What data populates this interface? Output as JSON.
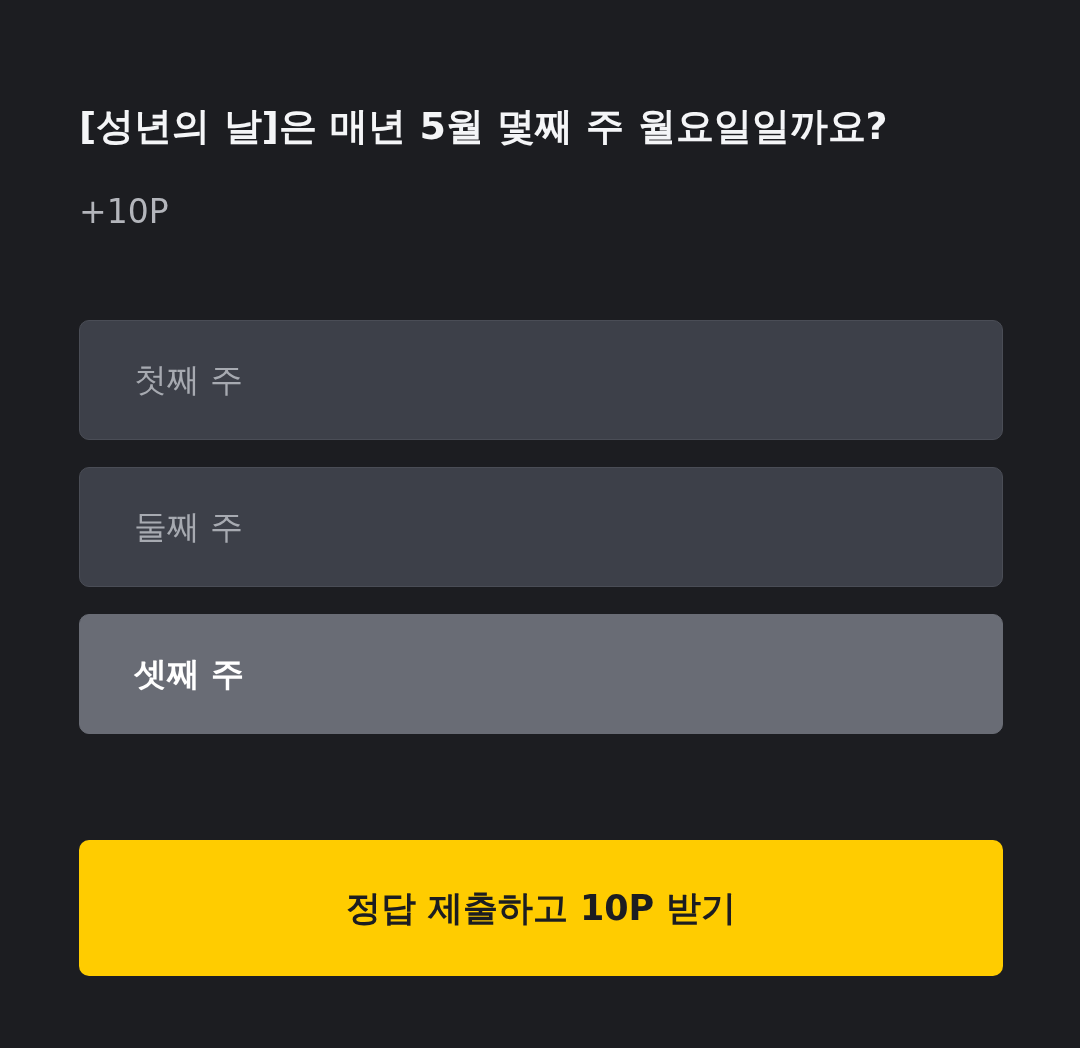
{
  "question": {
    "title": "[성년의 날]은 매년 5월 몇째 주 월요일일까요?",
    "points": "+10P"
  },
  "options": [
    {
      "label": "첫째 주",
      "selected": false
    },
    {
      "label": "둘째 주",
      "selected": false
    },
    {
      "label": "셋째 주",
      "selected": true
    }
  ],
  "submit_button": {
    "label": "정답 제출하고 10P 받기"
  }
}
